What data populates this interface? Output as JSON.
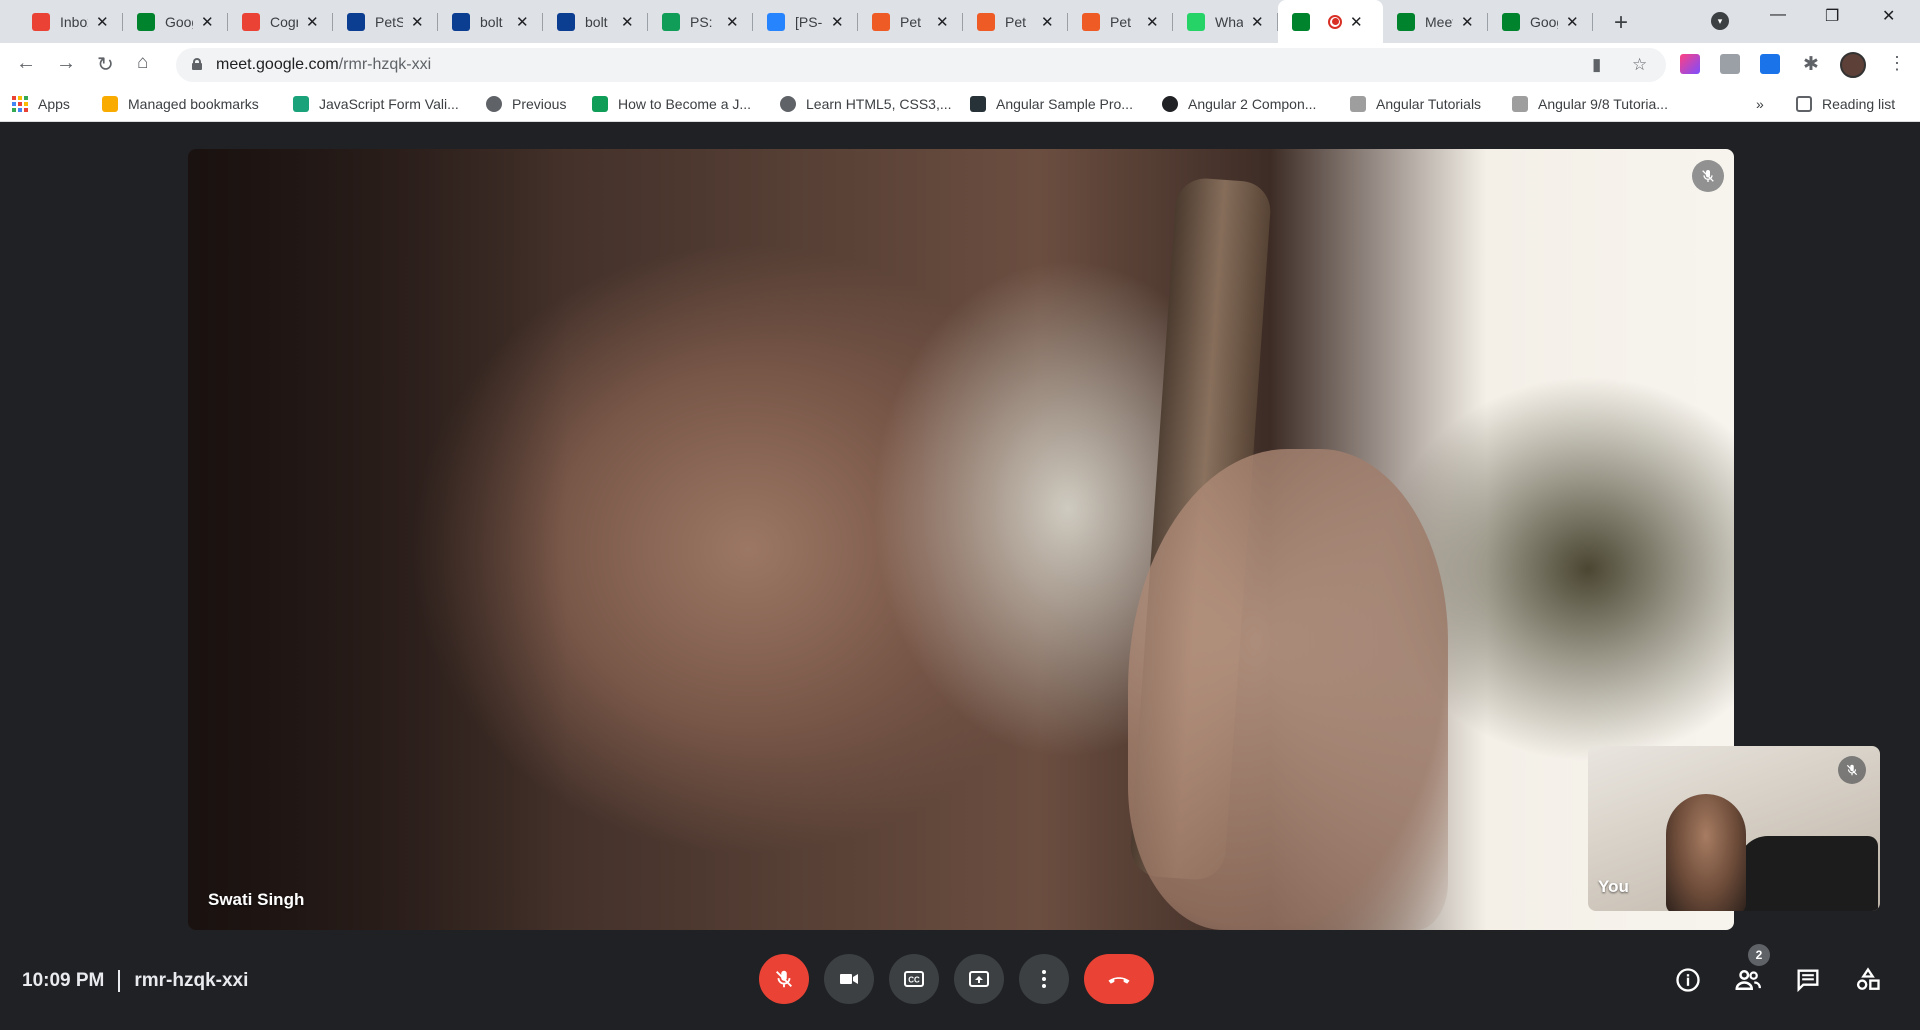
{
  "browser": {
    "tabs": [
      {
        "title": "Inbox",
        "icon": "gmail-icon",
        "color": "#ea4335"
      },
      {
        "title": "Google Meet",
        "icon": "meet-icon",
        "color": "#00832d"
      },
      {
        "title": "Cognizant",
        "icon": "gmail-icon",
        "color": "#ea4335"
      },
      {
        "title": "PetStore",
        "icon": "phpstorm-icon",
        "color": "#0b3d91"
      },
      {
        "title": "bolt",
        "icon": "phpstorm-icon",
        "color": "#0b3d91"
      },
      {
        "title": "bolt",
        "icon": "phpstorm-icon",
        "color": "#0b3d91"
      },
      {
        "title": "PS: ",
        "icon": "sheets-icon",
        "color": "#0f9d58"
      },
      {
        "title": "[PS-",
        "icon": "jira-icon",
        "color": "#2684ff"
      },
      {
        "title": "Pet",
        "icon": "postman-icon",
        "color": "#ef5b25"
      },
      {
        "title": "Pet",
        "icon": "postman-icon",
        "color": "#ef5b25"
      },
      {
        "title": "Pet",
        "icon": "postman-icon",
        "color": "#ef5b25"
      },
      {
        "title": "WhatsApp",
        "icon": "whatsapp-icon",
        "color": "#25d366"
      },
      {
        "title": "",
        "icon": "meet-icon",
        "color": "#00832d",
        "active": true
      },
      {
        "title": "Meet",
        "icon": "meet-icon",
        "color": "#00832d"
      },
      {
        "title": "Google",
        "icon": "meet-icon",
        "color": "#00832d"
      }
    ],
    "url_host": "meet.google.com",
    "url_path": "/rmr-hzqk-xxi",
    "bookmarks": [
      {
        "label": "Apps",
        "icon": "apps-grid-icon"
      },
      {
        "label": "Managed bookmarks",
        "icon": "folder-icon",
        "color": "#f9ab00"
      },
      {
        "label": "JavaScript Form Vali...",
        "icon": "shield-icon",
        "color": "#1aa37a"
      },
      {
        "label": "Previous",
        "icon": "globe-icon",
        "color": "#5f6368"
      },
      {
        "label": "How to Become a J...",
        "icon": "link-icon",
        "color": "#0f9d58"
      },
      {
        "label": "Learn HTML5, CSS3,...",
        "icon": "globe-icon",
        "color": "#5f6368"
      },
      {
        "label": "Angular Sample Pro...",
        "icon": "square-icon",
        "color": "#263238"
      },
      {
        "label": "Angular 2 Compon...",
        "icon": "code-icon",
        "color": "#202124"
      },
      {
        "label": "Angular Tutorials",
        "icon": "site-icon",
        "color": "#9e9e9e"
      },
      {
        "label": "Angular 9/8 Tutoria...",
        "icon": "site-icon",
        "color": "#9e9e9e"
      }
    ],
    "reading_list": "Reading list",
    "overflow": "»"
  },
  "meet": {
    "main_participant": "Swati Singh",
    "self_label": "You",
    "time": "10:09 PM",
    "meeting_code": "rmr-hzqk-xxi",
    "participant_count": "2",
    "colors": {
      "danger": "#ea4335",
      "control": "#3c4043",
      "background": "#202124"
    }
  }
}
